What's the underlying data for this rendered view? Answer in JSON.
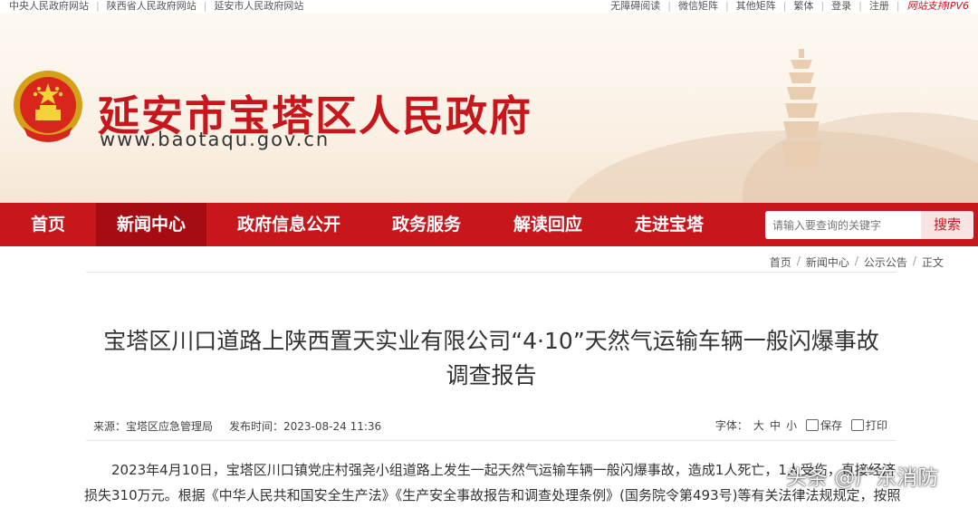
{
  "topbar": {
    "left_links": [
      "中央人民政府网站",
      "陕西省人民政府网站",
      "延安市人民政府网站"
    ],
    "right_links": [
      "无障碍阅读",
      "微信矩阵",
      "其他矩阵",
      "繁体",
      "登录",
      "注册"
    ],
    "ipv6": "网站支持IPV6"
  },
  "header": {
    "site_name": "延安市宝塔区人民政府",
    "site_url": "www.baotaqu.gov.cn"
  },
  "nav": {
    "items": [
      "首页",
      "新闻中心",
      "政府信息公开",
      "政务服务",
      "解读回应",
      "走进宝塔"
    ],
    "active": "新闻中心"
  },
  "search": {
    "placeholder": "请输入要查询的关键字",
    "button": "搜索"
  },
  "breadcrumb": [
    "首页",
    "新闻中心",
    "公示公告",
    "正文"
  ],
  "article": {
    "title_line1": "宝塔区川口道路上陕西置天实业有限公司“4·10”天然气运输车辆一般闪爆事故",
    "title_line2": "调查报告",
    "source": "来源：宝塔区应急管理局",
    "published": "发布时间：2023-08-24 11:36",
    "font_label": "字体：",
    "font_sizes": [
      "大",
      "中",
      "小"
    ],
    "save": "保存",
    "print": "打印",
    "para1": "2023年4月10日，宝塔区川口镇党庄村强尧小组道路上发生一起天然气运输车辆一般闪爆事故，造成1人死亡，1人受伤，直接经济损失310万元。根据《中华人民共和国安全生产法》《生产安全事故报告和调查处理条例》(国务院令第493号)等有关法律法规规定，按照"
  },
  "watermark": "头条 @广东消防",
  "colors": {
    "brand_red": "#c8161d",
    "nav_active": "#a50d13"
  }
}
